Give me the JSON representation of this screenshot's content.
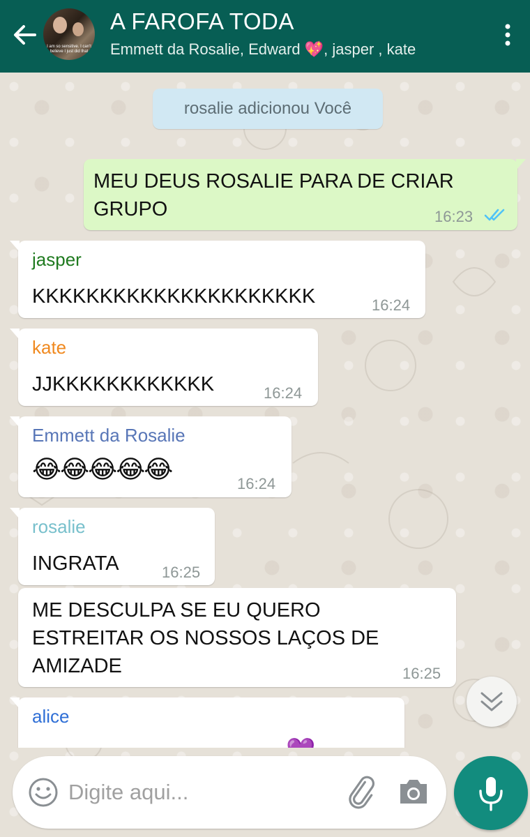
{
  "header": {
    "title": "A FAROFA TODA",
    "subtitle": "Emmett da Rosalie, Edward 💖, jasper , kate",
    "avatar_caption": "I am so sensitive. I can't believe I just did that"
  },
  "colors": {
    "header": "#075e54",
    "outgoing_bubble": "#dcf8c6",
    "system_bubble": "#d1e8f3",
    "mic_button": "#128c7e",
    "read_ticks": "#4fc3f7",
    "sender_jasper": "#1f7a1f",
    "sender_kate": "#f0891f",
    "sender_emmett": "#5876b7",
    "sender_rosalie": "#78c0cc",
    "sender_alice": "#2f6fd6"
  },
  "system_message": "rosalie adicionou Você",
  "messages": [
    {
      "direction": "out",
      "text_lines": [
        "MEU DEUS ROSALIE PARA DE CRIAR",
        "GRUPO"
      ],
      "time": "16:23",
      "status_icon": "double-check-read-icon"
    },
    {
      "direction": "in",
      "sender": "jasper",
      "text": "KKKKKKKKKKKKKKKKKKKKK",
      "time": "16:24"
    },
    {
      "direction": "in",
      "sender": "kate",
      "text": "JJKKKKKKKKKKKK",
      "time": "16:24"
    },
    {
      "direction": "in",
      "sender": "Emmett da Rosalie",
      "text": "😂😂😂😂😂",
      "time": "16:24"
    },
    {
      "direction": "in",
      "sender": "rosalie",
      "text": "INGRATA",
      "time": "16:25"
    },
    {
      "direction": "in",
      "text_lines": [
        "ME DESCULPA SE EU QUERO",
        "ESTREITAR OS NOSSOS LAÇOS DE",
        "AMIZADE"
      ],
      "time": "16:25"
    },
    {
      "direction": "in",
      "sender": "alice",
      "text_partial": "💜"
    }
  ],
  "composer": {
    "placeholder": "Digite aqui...",
    "emoji_icon": "smiley-face-icon",
    "attach_icon": "paperclip-icon",
    "camera_icon": "camera-icon",
    "mic_icon": "microphone-icon"
  },
  "scroll_button_icon": "double-chevron-down-icon"
}
